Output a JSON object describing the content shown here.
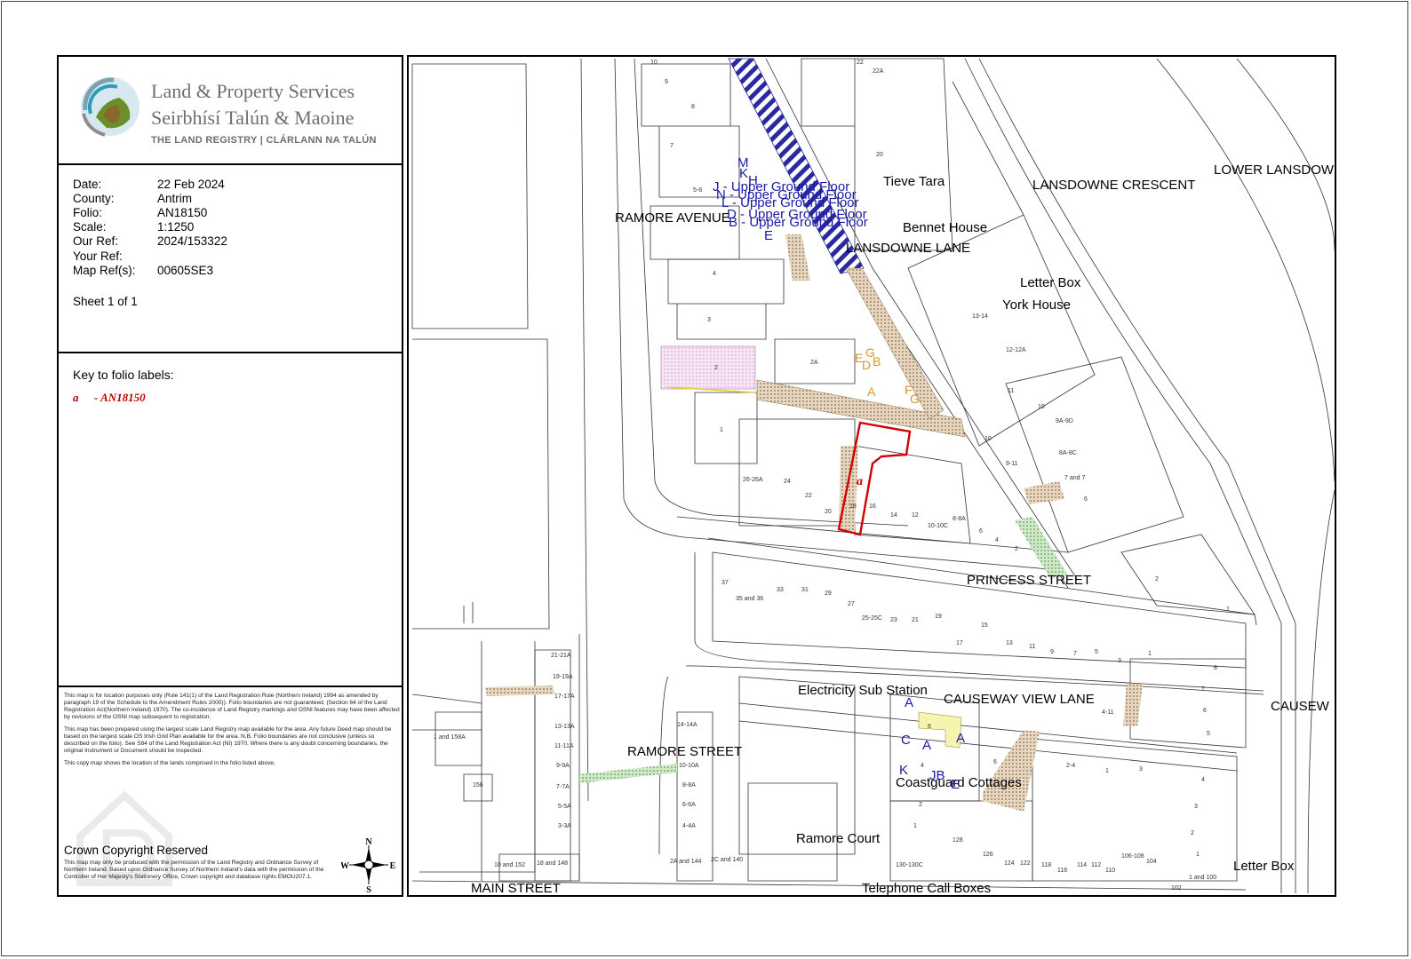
{
  "logo": {
    "line1": "Land & Property Services",
    "line2": "Seirbhísí Talún & Maoine",
    "line3": "THE LAND REGISTRY | CLÁRLANN NA TALÚN"
  },
  "info": {
    "rows": [
      {
        "label": "Date:",
        "value": "22 Feb 2024"
      },
      {
        "label": "County:",
        "value": "Antrim"
      },
      {
        "label": "Folio:",
        "value": "AN18150"
      },
      {
        "label": "Scale:",
        "value": "1:1250"
      },
      {
        "label": "Our Ref:",
        "value": "2024/153322"
      },
      {
        "label": "Your Ref:",
        "value": ""
      },
      {
        "label": "Map Ref(s):",
        "value": "00605SE3"
      }
    ],
    "sheet": "Sheet 1 of 1"
  },
  "key": {
    "title": "Key to folio labels:",
    "items": [
      {
        "code": "a",
        "folio": "- AN18150"
      }
    ]
  },
  "notes": {
    "p1": "This map is for location purposes only (Rule 141(1) of the Land Registration Rule (Northern Ireland) 1994 as amended by paragraph 19 of the Schedule to the Amendment Rules 2000)). Folio boundaries are not guaranteed, (Section 64 of the Land Registration Act(Northern Ireland) 1970). The co-incidence of Land Registry markings and OSNI features may have been affected by revisions of the OSNI map subsequent to registration.",
    "p2": "This map has been prepared using the largest scale Land Registry map available for the area. Any future Deed map should be based on the largest scale OS Irish Grid Plan available for the area. N.B. Folio boundaries are not conclusive (unless so described on the folio). See S84 of the Land Registration Act (NI) 1970. Where there is any doubt concerning boundaries, the original Instrument or Document should be inspected.",
    "p3": "This copy map shows the location of the lands comprised in the folio listed above.",
    "crown": "Crown Copyright Reserved",
    "crown_note": "This map may only be produced with the permission of the Land Registry and Ordnance Survey of Northern Ireland. Based upon Ordnance Survey of Northern Ireland's data with the permission of the Controller of Her Majesty's Stationery Office, Crown copyright and database rights EMOU207.1."
  },
  "compass": {
    "n": "N",
    "s": "S",
    "e": "E",
    "w": "W"
  },
  "map": {
    "streets": {
      "ramore_avenue": "RAMORE AVENUE",
      "lansdowne_lane": "LANSDOWNE LANE",
      "lansdowne_crescent": "LANSDOWNE CRESCENT",
      "lower_lansdowne": "LOWER LANSDOW",
      "princess_street": "PRINCESS STREET",
      "causeway_view_lane": "CAUSEWAY VIEW LANE",
      "causeway": "CAUSEW",
      "ramore_street": "RAMORE STREET",
      "main_street": "MAIN STREET"
    },
    "places": {
      "tieve_tara": "Tieve Tara",
      "bennet_house": "Bennet House",
      "letter_box_1": "Letter Box",
      "york_house": "York House",
      "electricity": "Electricity Sub Station",
      "coastguard": "Coastguard Cottages",
      "ramore_court": "Ramore Court",
      "telephone": "Telephone Call Boxes",
      "letter_box_2": "Letter Box"
    },
    "folio_label": "a",
    "blue_labels": [
      "J - Upper Ground Floor",
      "N - Upper Ground Floor",
      "L - Upper Ground Floor",
      "D - Upper Ground Floor",
      "B - Upper Ground Floor"
    ],
    "blue_letters": {
      "m": "M",
      "k": "K",
      "h": "H",
      "e": "E",
      "a1": "A",
      "c": "C",
      "a2": "A",
      "a3": "A",
      "k2": "K",
      "jb": "JB",
      "e2": "E"
    },
    "orange_letters": {
      "e": "E",
      "g1": "G",
      "d": "D",
      "b": "B",
      "a": "A",
      "f": "F",
      "g2": "G"
    },
    "numbers": {
      "n10": "10",
      "n9": "9",
      "n8": "8",
      "n7": "7",
      "n56": "5-6",
      "n4": "4",
      "n3": "3",
      "n2": "2",
      "n2a": "2A",
      "n1": "1",
      "n22": "22",
      "n22a": "22A",
      "n20": "20",
      "n1314": "13-14",
      "n1212a": "12-12A",
      "n11": "11",
      "n10b": "10",
      "n9a9d": "9A-9D",
      "n10c": "10",
      "n8a8c": "8A-8C",
      "n911": "9-11",
      "n7and8": "7 and 7",
      "n6": "6",
      "n2626a": "26-26A",
      "n24": "24",
      "n22b": "22",
      "n20b": "20",
      "n18": "18",
      "n16": "16",
      "n14": "14",
      "n12": "12",
      "n1010c": "10-10C",
      "n88a": "8-8A",
      "n6b": "6",
      "n4b": "4",
      "n2b": "2",
      "n37": "37",
      "n3536": "35 and 36",
      "n33": "33",
      "n31": "31",
      "n29": "29",
      "n27": "27",
      "n2525c": "25-25C",
      "n23": "23",
      "n21": "21",
      "n19": "19",
      "n17": "17",
      "n15": "15",
      "n13": "13",
      "n11b": "11",
      "n9b": "9",
      "n7b": "7",
      "n5": "5",
      "n3b": "3",
      "n1b": "1",
      "n2c": "2",
      "n1c": "1",
      "n8b": "8",
      "n7c": "7",
      "n6c": "6",
      "n5b": "5",
      "n411": "4-11",
      "n2121a": "21-21A",
      "n1919a": "19-19A",
      "n1717a": "17-17A",
      "n1313a": "13-13A",
      "n1111a": "11-11A",
      "n99a": "9-9A",
      "n77a": "7-7A",
      "n55a": "5-5A",
      "n33a": "3-3A",
      "n1and158a": "1 and 158A",
      "n156": "156",
      "n10and152": "10 and 152",
      "n18and148": "18 and 148",
      "n1414a": "14-14A",
      "n1010a": "10-10A",
      "n88ab": "8-8A",
      "n66a": "6-6A",
      "n44a": "4-4A",
      "n2aand144": "2A and 144",
      "n2cand140": "2C and 140",
      "n6d": "6",
      "n4c": "4",
      "n2d": "2",
      "n1d": "1",
      "n6e": "6",
      "n130": "130-130C",
      "n128": "128",
      "n126": "126",
      "n124": "124",
      "n122": "122",
      "n118": "118",
      "n116": "116",
      "n114": "114",
      "n112": "112",
      "n110": "110",
      "n106": "106-108",
      "n104": "104",
      "n102": "102",
      "n1and100": "1 and 100",
      "n24b": "2-4",
      "n1e": "1",
      "n3c": "3",
      "n4d": "4",
      "n3d": "3",
      "n2e": "2",
      "n1f": "1"
    }
  }
}
